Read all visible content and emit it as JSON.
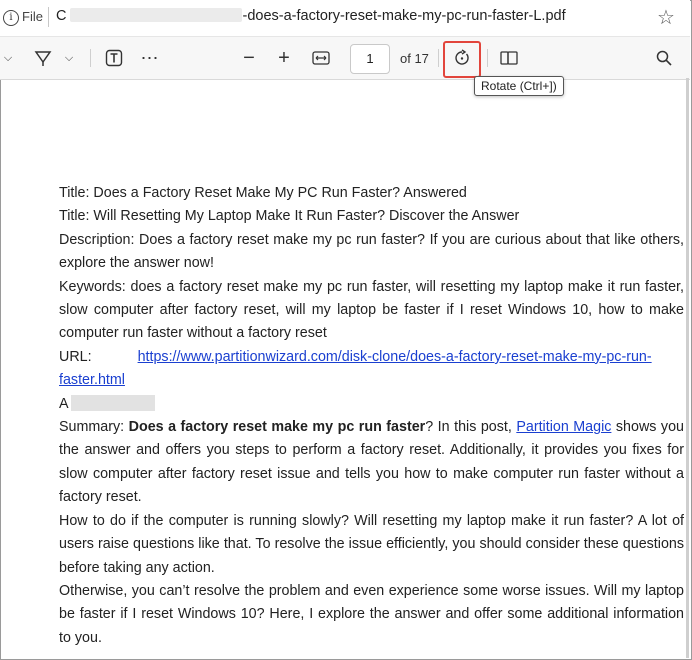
{
  "addressbar": {
    "file_label": "File",
    "url_visible": "-does-a-factory-reset-make-my-pc-run-faster-L.pdf",
    "url_prefix": "C"
  },
  "toolbar": {
    "page_number": "1",
    "page_total": "of 17",
    "rotate_tooltip": "Rotate (Ctrl+])"
  },
  "doc": {
    "title1": "Title: Does a Factory Reset Make My PC Run Faster? Answered",
    "title2": "Title: Will Resetting My Laptop Make It Run Faster? Discover the Answer",
    "description": "Description: Does a factory reset make my pc run faster? If you are curious about that like others, explore the answer now!",
    "keywords": "Keywords: does a factory reset make my pc run faster, will resetting my laptop make it run faster, slow computer after factory reset, will my laptop be faster if I reset Windows 10, how to make computer run faster without a factory reset",
    "url_label": "URL:",
    "url_link_line1": "https://www.partitionwizard.com/disk-clone/does-a-factory-reset-make-my-pc-run-",
    "url_link_line2": "faster.html",
    "author_initial": "A",
    "summary_label": "Summary: ",
    "summary_bold": "Does a factory reset make my pc run faster",
    "summary_mid": "? In this post, ",
    "summary_link": "Partition Magic",
    "summary_rest": " shows you the answer and offers you steps to perform a factory reset. Additionally, it provides you fixes for slow computer after factory reset issue and tells you how to make computer run faster without a factory reset.",
    "para1": "How to do if the computer is running slowly? Will resetting my laptop make it run faster? A lot of users raise questions like that. To resolve the issue efficiently, you should consider these questions before taking any action.",
    "para2": "Otherwise, you can’t resolve the problem and even experience some worse issues. Will my laptop be faster if I reset Windows 10? Here, I explore the answer and offer some additional information to you."
  }
}
